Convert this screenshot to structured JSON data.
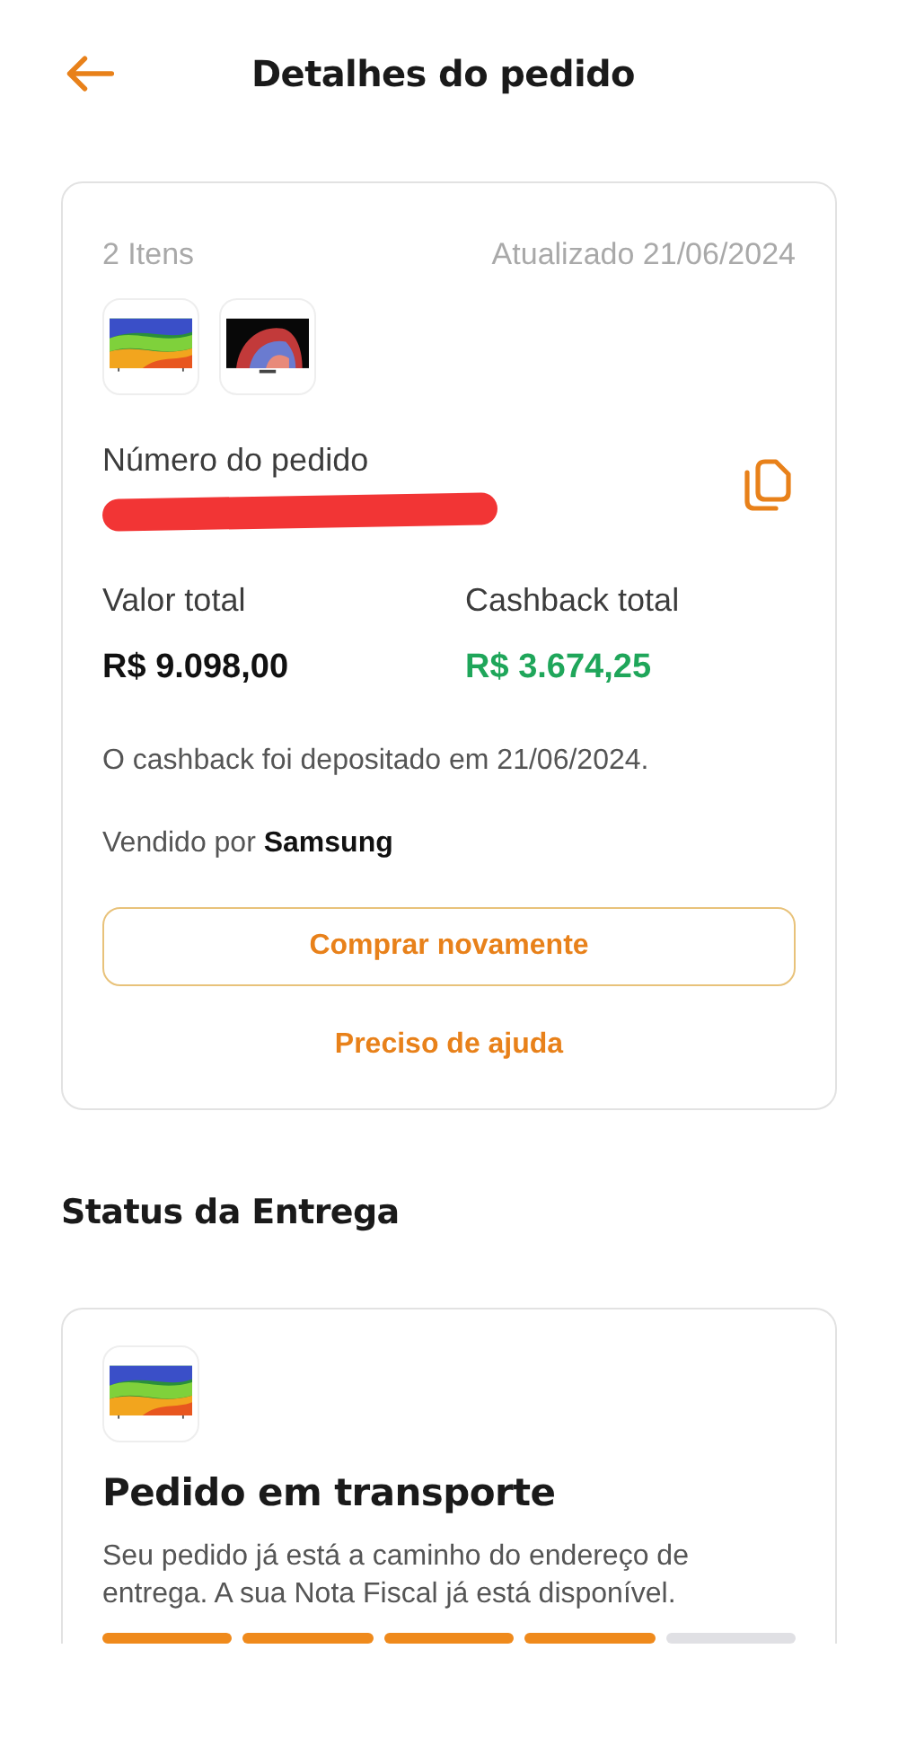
{
  "header": {
    "title": "Detalhes do pedido"
  },
  "order": {
    "item_count": "2 Itens",
    "updated": "Atualizado 21/06/2024",
    "number_label": "Número do pedido",
    "total_label": "Valor total",
    "total_value": "R$ 9.098,00",
    "cashback_label": "Cashback total",
    "cashback_value": "R$ 3.674,25",
    "cashback_note": "O cashback foi depositado em 21/06/2024.",
    "seller": "Vendido por **Samsung**",
    "buy_again": "Comprar novamente",
    "help": "Preciso de ajuda"
  },
  "delivery": {
    "section_title": "Status da Entrega",
    "status": "Pedido em transporte",
    "description": "Seu pedido já está a caminho do endereço de entrega. A sua Nota Fiscal já está disponível.",
    "steps": [
      {
        "done": true
      },
      {
        "done": true
      },
      {
        "done": true
      },
      {
        "done": true
      },
      {
        "done": false
      }
    ]
  }
}
